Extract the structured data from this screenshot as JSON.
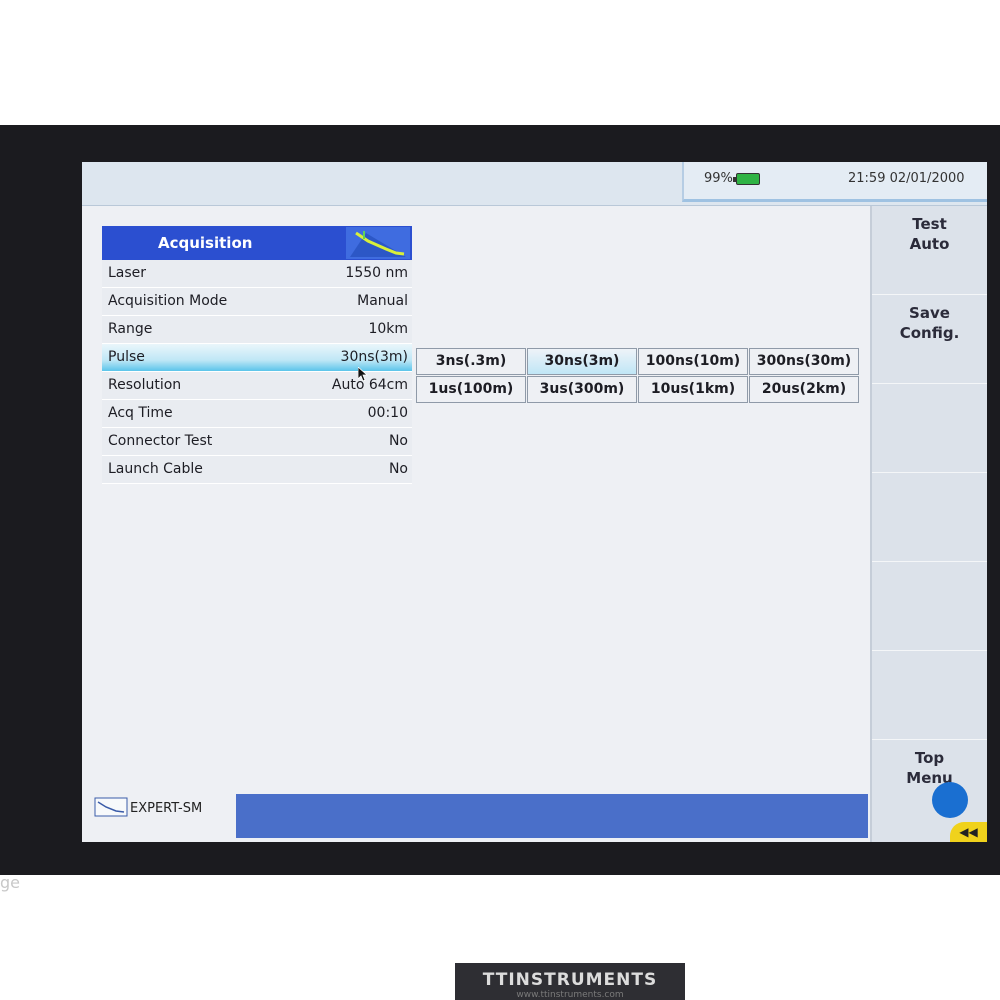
{
  "status": {
    "battery_percent": "99%",
    "clock": "21:59  02/01/2000"
  },
  "acquisition": {
    "title": "Acquisition",
    "rows": [
      {
        "label": "Laser",
        "value": "1550 nm"
      },
      {
        "label": "Acquisition Mode",
        "value": "Manual"
      },
      {
        "label": "Range",
        "value": "10km"
      },
      {
        "label": "Pulse",
        "value": "30ns(3m)"
      },
      {
        "label": "Resolution",
        "value": "Auto 64cm"
      },
      {
        "label": "Acq Time",
        "value": "00:10"
      },
      {
        "label": "Connector Test",
        "value": "No"
      },
      {
        "label": "Launch Cable",
        "value": "No"
      }
    ],
    "selected_row": "Pulse"
  },
  "pulse_options": {
    "options": [
      "3ns(.3m)",
      "30ns(3m)",
      "100ns(10m)",
      "300ns(30m)",
      "1us(100m)",
      "3us(300m)",
      "10us(1km)",
      "20us(2km)"
    ],
    "selected": "30ns(3m)"
  },
  "softkeys": {
    "test_auto": "Test\nAuto",
    "save_config": "Save\nConfig.",
    "top_menu": "Top\nMenu"
  },
  "footer": {
    "mode_label": "EXPERT-SM"
  },
  "device": {
    "brand": "TTINSTRUMENTS",
    "brand_url": "www.ttinstruments.com",
    "side_text": "ge"
  },
  "colors": {
    "header_blue": "#2b4fd0",
    "footer_blue": "#4a6fc9",
    "selection_cyan": "#5bc4ea",
    "battery_green": "#2fb344"
  }
}
